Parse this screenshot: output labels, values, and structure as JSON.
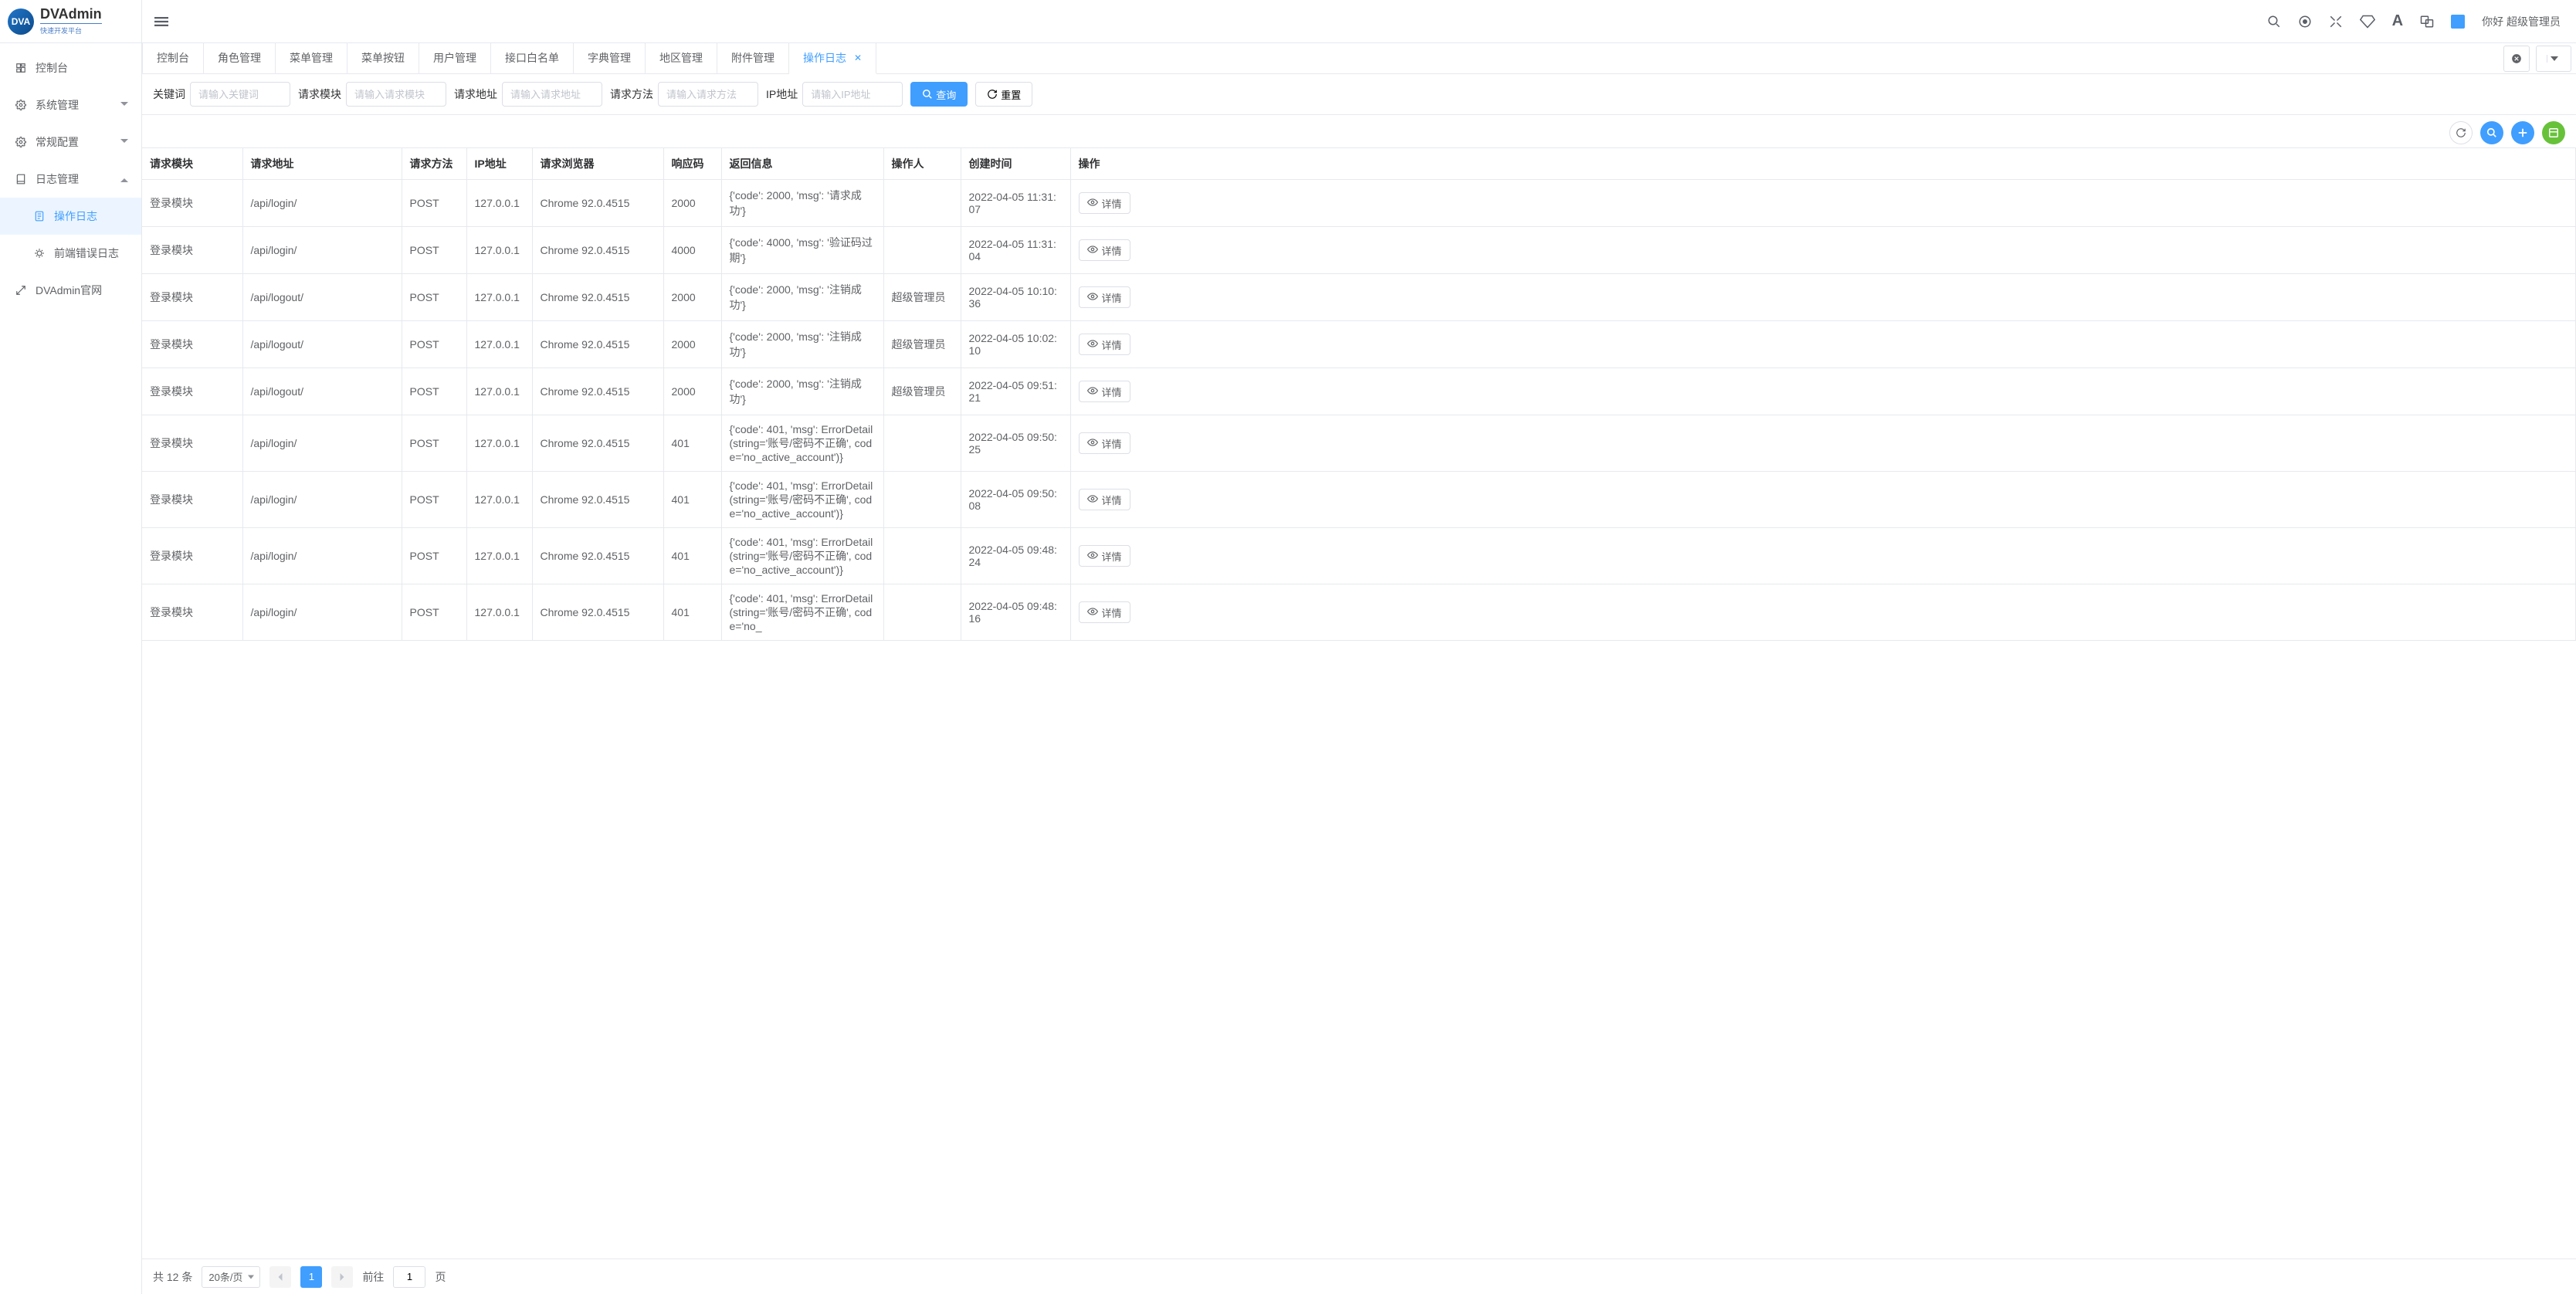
{
  "logo": {
    "abbr": "DVA",
    "title": "DVAdmin",
    "subtitle": "快速开发平台"
  },
  "sidebar": {
    "items": [
      {
        "label": "控制台"
      },
      {
        "label": "系统管理",
        "expand": true
      },
      {
        "label": "常规配置",
        "expand": true
      },
      {
        "label": "日志管理",
        "expand": true,
        "open": true,
        "children": [
          {
            "label": "操作日志",
            "active": true
          },
          {
            "label": "前端错误日志"
          }
        ]
      },
      {
        "label": "DVAdmin官网"
      }
    ]
  },
  "header": {
    "greeting": "你好 超级管理员"
  },
  "tabs": {
    "items": [
      "控制台",
      "角色管理",
      "菜单管理",
      "菜单按钮",
      "用户管理",
      "接口白名单",
      "字典管理",
      "地区管理",
      "附件管理",
      "操作日志"
    ],
    "active": "操作日志"
  },
  "search": {
    "fields": {
      "keyword": {
        "label": "关键词",
        "placeholder": "请输入关键词"
      },
      "module": {
        "label": "请求模块",
        "placeholder": "请输入请求模块"
      },
      "url": {
        "label": "请求地址",
        "placeholder": "请输入请求地址"
      },
      "method": {
        "label": "请求方法",
        "placeholder": "请输入请求方法"
      },
      "ip": {
        "label": "IP地址",
        "placeholder": "请输入IP地址"
      }
    },
    "btn_search": "查询",
    "btn_reset": "重置"
  },
  "table": {
    "columns": {
      "module": "请求模块",
      "url": "请求地址",
      "method": "请求方法",
      "ip": "IP地址",
      "browser": "请求浏览器",
      "code": "响应码",
      "msg": "返回信息",
      "operator": "操作人",
      "time": "创建时间",
      "action": "操作"
    },
    "detail_label": "详情",
    "rows": [
      {
        "module": "登录模块",
        "url": "/api/login/",
        "method": "POST",
        "ip": "127.0.0.1",
        "browser": "Chrome 92.0.4515",
        "code": "2000",
        "msg": "{'code': 2000, 'msg': '请求成功'}",
        "operator": "",
        "time": "2022-04-05 11:31:07"
      },
      {
        "module": "登录模块",
        "url": "/api/login/",
        "method": "POST",
        "ip": "127.0.0.1",
        "browser": "Chrome 92.0.4515",
        "code": "4000",
        "msg": "{'code': 4000, 'msg': '验证码过期'}",
        "operator": "",
        "time": "2022-04-05 11:31:04"
      },
      {
        "module": "登录模块",
        "url": "/api/logout/",
        "method": "POST",
        "ip": "127.0.0.1",
        "browser": "Chrome 92.0.4515",
        "code": "2000",
        "msg": "{'code': 2000, 'msg': '注销成功'}",
        "operator": "超级管理员",
        "time": "2022-04-05 10:10:36"
      },
      {
        "module": "登录模块",
        "url": "/api/logout/",
        "method": "POST",
        "ip": "127.0.0.1",
        "browser": "Chrome 92.0.4515",
        "code": "2000",
        "msg": "{'code': 2000, 'msg': '注销成功'}",
        "operator": "超级管理员",
        "time": "2022-04-05 10:02:10"
      },
      {
        "module": "登录模块",
        "url": "/api/logout/",
        "method": "POST",
        "ip": "127.0.0.1",
        "browser": "Chrome 92.0.4515",
        "code": "2000",
        "msg": "{'code': 2000, 'msg': '注销成功'}",
        "operator": "超级管理员",
        "time": "2022-04-05 09:51:21"
      },
      {
        "module": "登录模块",
        "url": "/api/login/",
        "method": "POST",
        "ip": "127.0.0.1",
        "browser": "Chrome 92.0.4515",
        "code": "401",
        "msg": "{'code': 401, 'msg': ErrorDetail(string='账号/密码不正确', code='no_active_account')}",
        "operator": "",
        "time": "2022-04-05 09:50:25"
      },
      {
        "module": "登录模块",
        "url": "/api/login/",
        "method": "POST",
        "ip": "127.0.0.1",
        "browser": "Chrome 92.0.4515",
        "code": "401",
        "msg": "{'code': 401, 'msg': ErrorDetail(string='账号/密码不正确', code='no_active_account')}",
        "operator": "",
        "time": "2022-04-05 09:50:08"
      },
      {
        "module": "登录模块",
        "url": "/api/login/",
        "method": "POST",
        "ip": "127.0.0.1",
        "browser": "Chrome 92.0.4515",
        "code": "401",
        "msg": "{'code': 401, 'msg': ErrorDetail(string='账号/密码不正确', code='no_active_account')}",
        "operator": "",
        "time": "2022-04-05 09:48:24"
      },
      {
        "module": "登录模块",
        "url": "/api/login/",
        "method": "POST",
        "ip": "127.0.0.1",
        "browser": "Chrome 92.0.4515",
        "code": "401",
        "msg": "{'code': 401, 'msg': ErrorDetail(string='账号/密码不正确', code='no_",
        "operator": "",
        "time": "2022-04-05 09:48:16"
      }
    ]
  },
  "pager": {
    "total_prefix": "共",
    "total_count": "12",
    "total_suffix": "条",
    "page_size": "20条/页",
    "current": "1",
    "goto": "前往",
    "goto_suffix": "页"
  }
}
